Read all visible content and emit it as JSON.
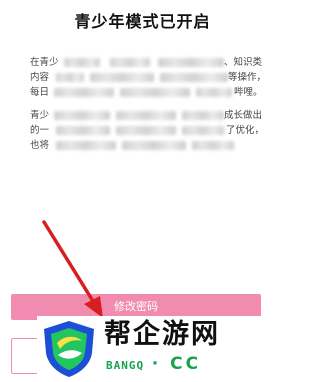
{
  "title": "青少年模式已开启",
  "paragraph1": {
    "line1_start": "在青少",
    "line1_end": "、知识类",
    "line2_start": "内容",
    "line2_end": "等操作，",
    "line3_start": "每日",
    "line3_end": "哔哩。"
  },
  "paragraph2": {
    "line1_start": "青少",
    "line1_end": "成长做出",
    "line2_start": "的一",
    "line2_end": "了优化，",
    "line3_start": "也将"
  },
  "buttons": {
    "primary_label": "修改密码"
  },
  "watermark": {
    "brand": "帮企游网",
    "domain": "BANGQ",
    "tld": "· CC"
  },
  "colors": {
    "accent": "#f28bb0",
    "arrow": "#d62020",
    "watermark_green": "#16a34a"
  }
}
